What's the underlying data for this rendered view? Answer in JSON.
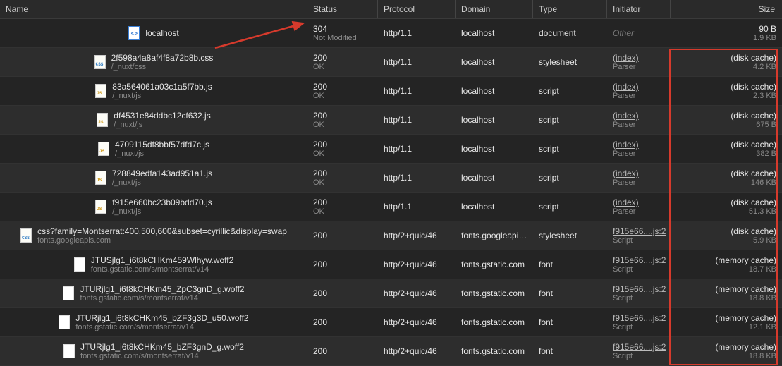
{
  "headers": {
    "name": "Name",
    "status": "Status",
    "protocol": "Protocol",
    "domain": "Domain",
    "type": "Type",
    "initiator": "Initiator",
    "size": "Size"
  },
  "rows": [
    {
      "icon": "doc",
      "name1": "localhost",
      "name2": "",
      "status1": "304",
      "status2": "Not Modified",
      "protocol": "http/1.1",
      "domain": "localhost",
      "type": "document",
      "initiator1": "Other",
      "initiator1_style": "other",
      "initiator2": "",
      "size1": "90 B",
      "size2": "1.9 KB"
    },
    {
      "icon": "css",
      "name1": "2f598a4a8af4f8a72b8b.css",
      "name2": "/_nuxt/css",
      "status1": "200",
      "status2": "OK",
      "protocol": "http/1.1",
      "domain": "localhost",
      "type": "stylesheet",
      "initiator1": "(index)",
      "initiator1_style": "link",
      "initiator2": "Parser",
      "size1": "(disk cache)",
      "size2": "4.2 KB"
    },
    {
      "icon": "js",
      "name1": "83a564061a03c1a5f7bb.js",
      "name2": "/_nuxt/js",
      "status1": "200",
      "status2": "OK",
      "protocol": "http/1.1",
      "domain": "localhost",
      "type": "script",
      "initiator1": "(index)",
      "initiator1_style": "link",
      "initiator2": "Parser",
      "size1": "(disk cache)",
      "size2": "2.3 KB"
    },
    {
      "icon": "js",
      "name1": "df4531e84ddbc12cf632.js",
      "name2": "/_nuxt/js",
      "status1": "200",
      "status2": "OK",
      "protocol": "http/1.1",
      "domain": "localhost",
      "type": "script",
      "initiator1": "(index)",
      "initiator1_style": "link",
      "initiator2": "Parser",
      "size1": "(disk cache)",
      "size2": "675 B"
    },
    {
      "icon": "js",
      "name1": "4709115df8bbf57dfd7c.js",
      "name2": "/_nuxt/js",
      "status1": "200",
      "status2": "OK",
      "protocol": "http/1.1",
      "domain": "localhost",
      "type": "script",
      "initiator1": "(index)",
      "initiator1_style": "link",
      "initiator2": "Parser",
      "size1": "(disk cache)",
      "size2": "382 B"
    },
    {
      "icon": "js",
      "name1": "728849edfa143ad951a1.js",
      "name2": "/_nuxt/js",
      "status1": "200",
      "status2": "OK",
      "protocol": "http/1.1",
      "domain": "localhost",
      "type": "script",
      "initiator1": "(index)",
      "initiator1_style": "link",
      "initiator2": "Parser",
      "size1": "(disk cache)",
      "size2": "146 KB"
    },
    {
      "icon": "js",
      "name1": "f915e660bc23b09bdd70.js",
      "name2": "/_nuxt/js",
      "status1": "200",
      "status2": "OK",
      "protocol": "http/1.1",
      "domain": "localhost",
      "type": "script",
      "initiator1": "(index)",
      "initiator1_style": "link",
      "initiator2": "Parser",
      "size1": "(disk cache)",
      "size2": "51.3 KB"
    },
    {
      "icon": "css",
      "name1": "css?family=Montserrat:400,500,600&subset=cyrillic&display=swap",
      "name2": "fonts.googleapis.com",
      "status1": "200",
      "status2": "",
      "protocol": "http/2+quic/46",
      "domain": "fonts.googleapis...",
      "type": "stylesheet",
      "initiator1": "f915e66....js:2",
      "initiator1_style": "link",
      "initiator2": "Script",
      "size1": "(disk cache)",
      "size2": "5.9 KB"
    },
    {
      "icon": "blank",
      "name1": "JTUSjlg1_i6t8kCHKm459Wlhyw.woff2",
      "name2": "fonts.gstatic.com/s/montserrat/v14",
      "status1": "200",
      "status2": "",
      "protocol": "http/2+quic/46",
      "domain": "fonts.gstatic.com",
      "type": "font",
      "initiator1": "f915e66....js:2",
      "initiator1_style": "link",
      "initiator2": "Script",
      "size1": "(memory cache)",
      "size2": "18.7 KB"
    },
    {
      "icon": "blank",
      "name1": "JTURjlg1_i6t8kCHKm45_ZpC3gnD_g.woff2",
      "name2": "fonts.gstatic.com/s/montserrat/v14",
      "status1": "200",
      "status2": "",
      "protocol": "http/2+quic/46",
      "domain": "fonts.gstatic.com",
      "type": "font",
      "initiator1": "f915e66....js:2",
      "initiator1_style": "link",
      "initiator2": "Script",
      "size1": "(memory cache)",
      "size2": "18.8 KB"
    },
    {
      "icon": "blank",
      "name1": "JTURjlg1_i6t8kCHKm45_bZF3g3D_u50.woff2",
      "name2": "fonts.gstatic.com/s/montserrat/v14",
      "status1": "200",
      "status2": "",
      "protocol": "http/2+quic/46",
      "domain": "fonts.gstatic.com",
      "type": "font",
      "initiator1": "f915e66....js:2",
      "initiator1_style": "link",
      "initiator2": "Script",
      "size1": "(memory cache)",
      "size2": "12.1 KB"
    },
    {
      "icon": "blank",
      "name1": "JTURjlg1_i6t8kCHKm45_bZF3gnD_g.woff2",
      "name2": "fonts.gstatic.com/s/montserrat/v14",
      "status1": "200",
      "status2": "",
      "protocol": "http/2+quic/46",
      "domain": "fonts.gstatic.com",
      "type": "font",
      "initiator1": "f915e66....js:2",
      "initiator1_style": "link",
      "initiator2": "Script",
      "size1": "(memory cache)",
      "size2": "18.8 KB"
    }
  ]
}
